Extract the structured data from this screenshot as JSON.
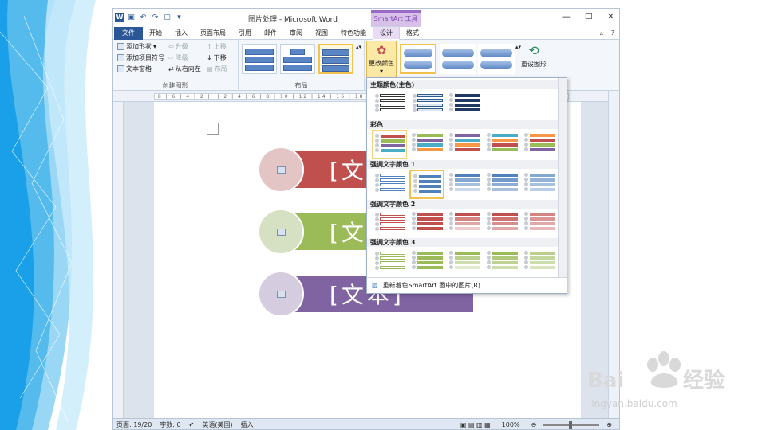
{
  "window": {
    "title": "图片处理 - Microsoft Word",
    "context_tab": "SmartArt 工具",
    "context_tab_purple": "工具",
    "context_tab_main": "SmartArt "
  },
  "tabs": [
    "文件",
    "开始",
    "插入",
    "页面布局",
    "引用",
    "邮件",
    "审阅",
    "视图",
    "特色功能",
    "设计",
    "格式"
  ],
  "ribbon": {
    "create_group": {
      "label": "创建图形",
      "add_shape": "添加形状",
      "add_bullet": "添加项目符号",
      "text_pane": "文本窗格",
      "promote": "升级",
      "demote": "降级",
      "rtl": "从右向左",
      "move_up": "上移",
      "move_down": "下移",
      "layout": "布局"
    },
    "layout_group": {
      "label": "布局"
    },
    "change_colors": "更改颜色",
    "reset_graphic": "重设图形"
  },
  "gallery": {
    "sections": [
      {
        "title": "主题颜色(主色)"
      },
      {
        "title": "彩色"
      },
      {
        "title": "强调文字颜色 1"
      },
      {
        "title": "强调文字颜色 2"
      },
      {
        "title": "强调文字颜色 3"
      }
    ],
    "footer": "重新着色SmartArt 图中的图片(R)",
    "colors": {
      "primary": [
        "#1f3864",
        "#2e5a8f",
        "#3d6aa8"
      ],
      "colorful": [
        "#c0504d",
        "#9bbb59",
        "#8064a2",
        "#4bacc6",
        "#f79646"
      ],
      "accent1": "#4f81bd",
      "accent2": "#c0504d",
      "accent3": "#9bbb59"
    }
  },
  "document": {
    "rows": [
      {
        "color": "#c0504d",
        "circle": "#e3c5c6",
        "text": "[文本]"
      },
      {
        "color": "#9bbb59",
        "circle": "#d6e0c2",
        "text": "[文本]"
      },
      {
        "color": "#8064a2",
        "circle": "#d5cce0",
        "text": "[文本]"
      }
    ]
  },
  "status": {
    "page": "页面: 19/20",
    "words": "字数: 0",
    "language": "英语(美国)",
    "mode": "插入",
    "zoom": "100%"
  },
  "watermark": {
    "brand": "Bai",
    "brand2": "du",
    "cn": "经验",
    "url": "jingyan.baidu.com"
  }
}
